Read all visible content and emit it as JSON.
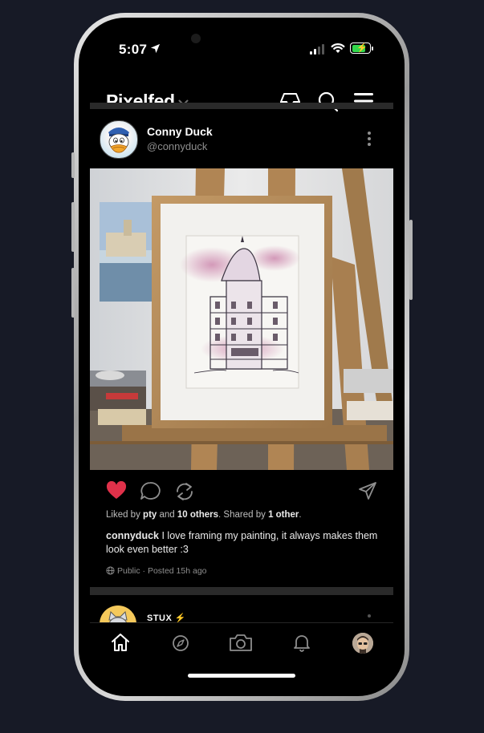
{
  "status_bar": {
    "time": "5:07",
    "location_icon": "location-arrow-icon",
    "signal_icon": "cellular-signal-icon",
    "wifi_icon": "wifi-icon",
    "battery_icon": "battery-charging-icon",
    "battery_color": "#32d74b"
  },
  "header": {
    "brand": "Pixelfed",
    "chevron_icon": "chevron-down-icon",
    "icons": [
      "inbox-icon",
      "search-icon",
      "menu-icon"
    ]
  },
  "post": {
    "author": {
      "display_name": "Conny Duck",
      "handle": "@connyduck",
      "avatar_icon": "duck-avatar"
    },
    "image": "framed watercolor painting on an easel",
    "liked": true,
    "like_color": "#e0314a",
    "actions": [
      "heart-icon",
      "comment-icon",
      "share-icon",
      "send-icon"
    ],
    "liked_by": {
      "prefix": "Liked by",
      "user": "pty",
      "and": "and",
      "others": "10 others",
      "shared_prefix": ". Shared by",
      "shared_count": "1 other",
      "end": "."
    },
    "caption": {
      "username": "connyduck",
      "text": "I love framing my painting, it always makes them look even better :3"
    },
    "visibility": "Public",
    "separator": "·",
    "posted": "Posted 15h ago"
  },
  "next_post": {
    "display_name": "STUX",
    "emoji": "⚡"
  },
  "tab_bar": {
    "tabs": [
      "home-icon",
      "compass-icon",
      "camera-icon",
      "bell-icon",
      "profile-avatar"
    ],
    "active": "home-icon"
  }
}
